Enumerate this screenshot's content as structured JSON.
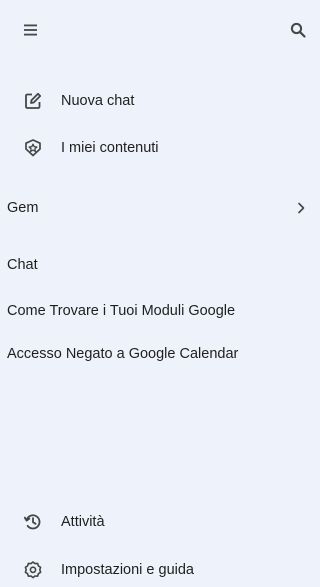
{
  "header": {
    "menu_icon": "hamburger-menu-icon",
    "search_icon": "search-icon"
  },
  "primary_actions": [
    {
      "label": "Nuova chat",
      "icon": "edit-square-icon"
    },
    {
      "label": "I miei contenuti",
      "icon": "star-shield-icon"
    }
  ],
  "gem_section": {
    "label": "Gem",
    "icon": "chevron-right-icon"
  },
  "chat_section": {
    "label": "Chat",
    "items": [
      "Come Trovare i Tuoi Moduli Google",
      "Accesso Negato a Google Calendar"
    ]
  },
  "footer_actions": [
    {
      "label": "Attività",
      "icon": "history-icon"
    },
    {
      "label": "Impostazioni e guida",
      "icon": "gear-icon"
    }
  ],
  "colors": {
    "background": "#eef2fa",
    "text": "#1f1f1f",
    "icon": "#444746"
  }
}
